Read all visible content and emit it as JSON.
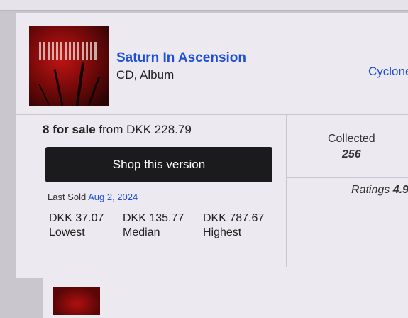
{
  "release": {
    "title": "Saturn In Ascension",
    "format": "CD, Album",
    "artist_partial": "Cyclone"
  },
  "sale": {
    "count_label": "8 for sale",
    "from_text": "from DKK 228.79",
    "shop_button": "Shop this version"
  },
  "last_sold": {
    "label": "Last Sold",
    "date": "Aug 2, 2024"
  },
  "stats": [
    {
      "value": "DKK 37.07",
      "label": "Lowest"
    },
    {
      "value": "DKK 135.77",
      "label": "Median"
    },
    {
      "value": "DKK 787.67",
      "label": "Highest"
    }
  ],
  "community": {
    "collected_label": "Collected",
    "collected_value": "256",
    "ratings_label": "Ratings",
    "ratings_value": "4.9"
  },
  "colors": {
    "link": "#1f4fd2",
    "button_bg": "#1b1b1d"
  }
}
